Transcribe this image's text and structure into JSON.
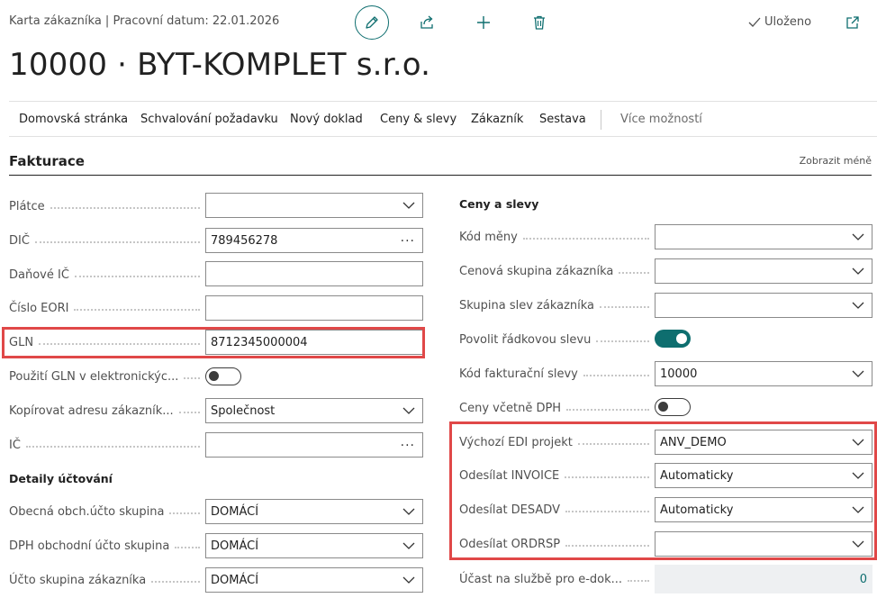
{
  "header": {
    "caption": "Karta zákazníka | Pracovní datum: 22.01.2026",
    "saved_label": "Uloženo",
    "title": "10000 · BYT-KOMPLET s.r.o."
  },
  "icons": {
    "edit": "pencil-icon",
    "share": "share-icon",
    "add": "plus-icon",
    "delete": "trash-icon",
    "saved": "check-icon",
    "popout": "open-in-new-window-icon"
  },
  "actions": {
    "items": [
      "Domovská stránka",
      "Schvalování požadavku",
      "Nový doklad",
      "Ceny & slevy",
      "Zákazník",
      "Sestava"
    ],
    "more": "Více možností"
  },
  "section": {
    "title": "Fakturace",
    "show_less": "Zobrazit méně"
  },
  "left": {
    "fields": [
      {
        "label": "Plátce",
        "value": "",
        "type": "dropdown"
      },
      {
        "label": "DIČ",
        "value": "789456278",
        "type": "lookup"
      },
      {
        "label": "Daňové IČ",
        "value": "",
        "type": "text"
      },
      {
        "label": "Číslo EORI",
        "value": "",
        "type": "text"
      },
      {
        "label": "GLN",
        "value": "8712345000004",
        "type": "text"
      },
      {
        "label": "Použití GLN v elektronickýc...",
        "value": false,
        "type": "toggle"
      },
      {
        "label": "Kopírovat adresu zákazník...",
        "value": "Společnost",
        "type": "dropdown"
      },
      {
        "label": "IČ",
        "value": "",
        "type": "lookup"
      }
    ],
    "posting_group_title": "Detaily účtování",
    "posting": [
      {
        "label": "Obecná obch.účto skupina",
        "value": "DOMÁCÍ",
        "type": "dropdown"
      },
      {
        "label": "DPH obchodní účto skupina",
        "value": "DOMÁCÍ",
        "type": "dropdown"
      },
      {
        "label": "Účto skupina zákazníka",
        "value": "DOMÁCÍ",
        "type": "dropdown"
      }
    ]
  },
  "right": {
    "group_title": "Ceny a slevy",
    "fields": [
      {
        "label": "Kód měny",
        "value": "",
        "type": "dropdown"
      },
      {
        "label": "Cenová skupina zákazníka",
        "value": "",
        "type": "dropdown"
      },
      {
        "label": "Skupina slev zákazníka",
        "value": "",
        "type": "dropdown"
      },
      {
        "label": "Povolit řádkovou slevu",
        "value": true,
        "type": "toggle"
      },
      {
        "label": "Kód fakturační slevy",
        "value": "10000",
        "type": "dropdown"
      },
      {
        "label": "Ceny včetně DPH",
        "value": false,
        "type": "toggle"
      },
      {
        "label": "Výchozí EDI projekt",
        "value": "ANV_DEMO",
        "type": "dropdown"
      },
      {
        "label": "Odesílat INVOICE",
        "value": "Automaticky",
        "type": "dropdown"
      },
      {
        "label": "Odesílat DESADV",
        "value": "Automaticky",
        "type": "dropdown"
      },
      {
        "label": "Odesílat ORDRSP",
        "value": "",
        "type": "dropdown"
      }
    ],
    "einvoice": {
      "label": "Účast na službě pro e-dok...",
      "value": "0"
    }
  },
  "colors": {
    "accent": "#0e6e6f",
    "highlight": "#e04848",
    "readonly_bg": "#eef0f2"
  }
}
